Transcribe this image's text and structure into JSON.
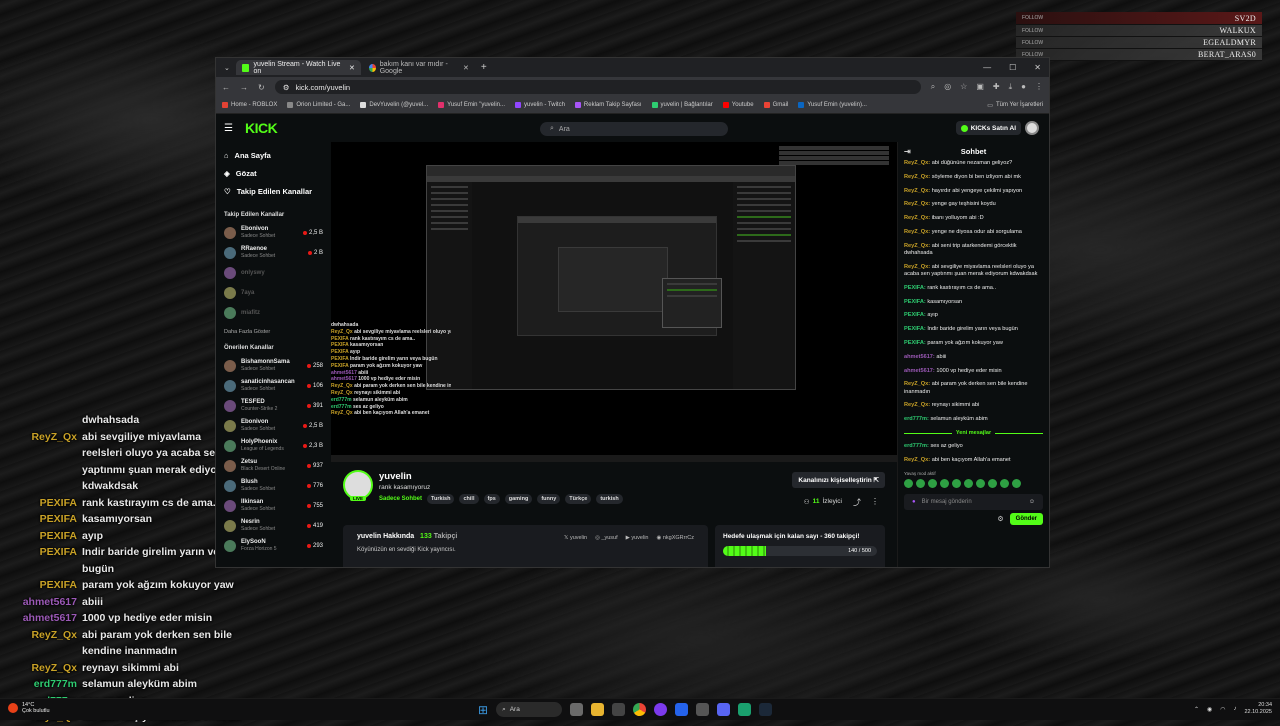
{
  "overlay_follows": [
    {
      "label": "FOLLOW",
      "name": "SV2D"
    },
    {
      "label": "FOLLOW",
      "name": "WALKUX"
    },
    {
      "label": "FOLLOW",
      "name": "EGEALDMYR"
    },
    {
      "label": "FOLLOW",
      "name": "BERAT_ARAS0"
    }
  ],
  "overlay_chat": [
    {
      "user": "",
      "msg": "dwhahsada",
      "color": "#e8e8e8"
    },
    {
      "user": "ReyZ_Qx",
      "msg": "abi sevgiliye miyavlama reelsleri oluyo ya acaba sen yaptınmı şuan merak ediyorum kdwakdsak",
      "color": "#c9a227"
    },
    {
      "user": "PEXIFA",
      "msg": "rank kastırayım cs de ama..",
      "color": "#c9a227"
    },
    {
      "user": "PEXIFA",
      "msg": "kasamıyorsan",
      "color": "#c9a227"
    },
    {
      "user": "PEXIFA",
      "msg": "ayıp",
      "color": "#c9a227"
    },
    {
      "user": "PEXIFA",
      "msg": "Indir baride girelim yarın veya bugün",
      "color": "#c9a227"
    },
    {
      "user": "PEXIFA",
      "msg": "param yok ağzım kokuyor yaw",
      "color": "#c9a227"
    },
    {
      "user": "ahmet5617",
      "msg": "abiii",
      "color": "#9b59b6"
    },
    {
      "user": "ahmet5617",
      "msg": "1000 vp hediye eder misin",
      "color": "#9b59b6"
    },
    {
      "user": "ReyZ_Qx",
      "msg": "abi param yok derken sen bile kendine inanmadın",
      "color": "#c9a227"
    },
    {
      "user": "ReyZ_Qx",
      "msg": "reynayı sikimmi abi",
      "color": "#c9a227"
    },
    {
      "user": "erd777m",
      "msg": "selamun aleyküm abim",
      "color": "#2ecc71"
    },
    {
      "user": "erd777m",
      "msg": "ses az geliyo",
      "color": "#2ecc71"
    },
    {
      "user": "ReyZ_Qx",
      "msg": "abi ben kaçıyom Allah'a emanet",
      "color": "#c9a227"
    }
  ],
  "browser": {
    "tabs": [
      {
        "label": "yuvelin Stream - Watch Live on"
      },
      {
        "label": "bakım kanı var mıdır - Google"
      }
    ],
    "url": "kick.com/yuvelin",
    "bookmarks": [
      "Home - ROBLOX",
      "Orion Limited - Ga...",
      "DevYuvelin (@yuvel...",
      "Yusuf Emin \"yuvelin...",
      "yuvelin - Twitch",
      "Reklam Takip Sayfası",
      "yuvelin | Bağlantılar",
      "Youtube",
      "Gmail",
      "Yusuf Emin (yuvelin)..."
    ],
    "all_bookmarks": "Tüm Yer İşaretleri"
  },
  "kick": {
    "logo": "KICK",
    "search_placeholder": "Ara",
    "buy_label": "KICKs Satın Al",
    "nav": [
      {
        "label": "Ana Sayfa",
        "icon": "home-icon"
      },
      {
        "label": "Gözat",
        "icon": "browse-icon"
      },
      {
        "label": "Takip Edilen Kanallar",
        "icon": "heart-icon"
      }
    ],
    "followed_title": "Takip Edilen Kanallar",
    "followed": [
      {
        "name": "Ebonivon",
        "sub": "Sadece Sohbet",
        "count": "2,5 B",
        "online": true
      },
      {
        "name": "RRaenoe",
        "sub": "Sadece Sohbet",
        "count": "2 B",
        "online": true
      },
      {
        "name": "onlyswy",
        "sub": "",
        "count": "",
        "online": false
      },
      {
        "name": "7aya",
        "sub": "",
        "count": "",
        "online": false
      },
      {
        "name": "miafitz",
        "sub": "",
        "count": "",
        "online": false
      }
    ],
    "show_more": "Daha Fazla Göster",
    "recommended_title": "Önerilen Kanallar",
    "recommended": [
      {
        "name": "BishamonnSama",
        "sub": "Sadece Sohbet",
        "count": "258"
      },
      {
        "name": "sanaticinhasancan",
        "sub": "Sadece Sohbet",
        "count": "106"
      },
      {
        "name": "TESFED",
        "sub": "Counter-Strike 2",
        "count": "391"
      },
      {
        "name": "Ebonivon",
        "sub": "Sadece Sohbet",
        "count": "2,5 B"
      },
      {
        "name": "HolyPhoenix",
        "sub": "League of Legends",
        "count": "2,3 B"
      },
      {
        "name": "Zetsu",
        "sub": "Black Desert Online",
        "count": "937"
      },
      {
        "name": "Blush",
        "sub": "Sadece Sohbet",
        "count": "776"
      },
      {
        "name": "Ilkinsan",
        "sub": "Sadece Sohbet",
        "count": "755"
      },
      {
        "name": "Nesrin",
        "sub": "Sadece Sohbet",
        "count": "419"
      },
      {
        "name": "ElySooN",
        "sub": "Forza Horizon 5",
        "count": "293"
      }
    ],
    "stream": {
      "name": "yuvelin",
      "title": "rank kasamıyoruz",
      "live": "LIVE",
      "category": "Sadece Sohbet",
      "tags": [
        "Turkish",
        "chill",
        "fps",
        "gaming",
        "funny",
        "Türkçe",
        "turkish"
      ],
      "customize": "Kanalınızı kişiselleştirin",
      "viewers": "11",
      "viewers_label": "İzleyici"
    },
    "about": {
      "title": "yuvelin Hakkında",
      "followers": "133",
      "followers_label": "Takipçi",
      "desc": "Köyünüzün en sevdiği Kick yayıncısı.",
      "socials": [
        "yuvelin",
        "_yusuf",
        "yuvelin",
        "nkgXGRrrCz"
      ]
    },
    "goal": {
      "title": "Hedefe ulaşmak için kalan sayı - 360 takipçi!",
      "value": "140 / 500",
      "progress": 0.28
    },
    "chat": {
      "title": "Sohbet",
      "messages": [
        {
          "user": "ReyZ_Qx:",
          "text": "abi düğününe nezaman geliyoz?",
          "color": "#c9a227"
        },
        {
          "user": "ReyZ_Qx:",
          "text": "söyleme diyon bi ben izliyom abi mk",
          "color": "#c9a227"
        },
        {
          "user": "ReyZ_Qx:",
          "text": "hayırdır abi yengeye çekilmi yapıyon",
          "color": "#c9a227"
        },
        {
          "user": "ReyZ_Qx:",
          "text": "yenge gay teşhisini koydu",
          "color": "#c9a227"
        },
        {
          "user": "ReyZ_Qx:",
          "text": "ibanı yolluyom abi :D",
          "color": "#c9a227"
        },
        {
          "user": "ReyZ_Qx:",
          "text": "yenge ne diyosa odur abi sorgulama",
          "color": "#c9a227"
        },
        {
          "user": "ReyZ_Qx:",
          "text": "abi seni trip atarkendemi görcektik dwhahsada",
          "color": "#c9a227"
        },
        {
          "user": "ReyZ_Qx:",
          "text": "abi sevgiliye miyavlama reelsleri oluyo ya acaba sen yaptınmı şuan merak ediyorum kdwakdsak",
          "color": "#c9a227"
        },
        {
          "user": "PEXIFA:",
          "text": "rank kastırayım cs de ama..",
          "color": "#2ecc71"
        },
        {
          "user": "PEXIFA:",
          "text": "kasamıyorsan",
          "color": "#2ecc71"
        },
        {
          "user": "PEXIFA:",
          "text": "ayıp",
          "color": "#2ecc71"
        },
        {
          "user": "PEXIFA:",
          "text": "Indir baride girelim yarın veya bugün",
          "color": "#2ecc71"
        },
        {
          "user": "PEXIFA:",
          "text": "param yok ağzım kokuyor yaw",
          "color": "#2ecc71"
        },
        {
          "user": "ahmet5617:",
          "text": "abiii",
          "color": "#9b59b6"
        },
        {
          "user": "ahmet5617:",
          "text": "1000 vp hediye eder misin",
          "color": "#9b59b6"
        },
        {
          "user": "ReyZ_Qx:",
          "text": "abi param yok derken sen bile kendine inanmadın",
          "color": "#c9a227"
        },
        {
          "user": "ReyZ_Qx:",
          "text": "reynayı sikimmi abi",
          "color": "#c9a227"
        },
        {
          "user": "erd777m:",
          "text": "selamun aleyküm abim",
          "color": "#2ecc71"
        }
      ],
      "new_messages": "Yeni mesajlar",
      "after_new": [
        {
          "user": "erd777m:",
          "text": "ses az geliyo",
          "color": "#2ecc71"
        },
        {
          "user": "ReyZ_Qx:",
          "text": "abi ben kaçıyom Allah'a emanet",
          "color": "#c9a227"
        }
      ],
      "slow_mode": "Yavaş mod aktif",
      "input_placeholder": "Bir mesaj gönderin",
      "send": "Gönder"
    }
  },
  "taskbar": {
    "temp": "14°C",
    "weather": "Çok bulutlu",
    "search": "Ara",
    "time": "20:34",
    "date": "22.10.2025"
  }
}
